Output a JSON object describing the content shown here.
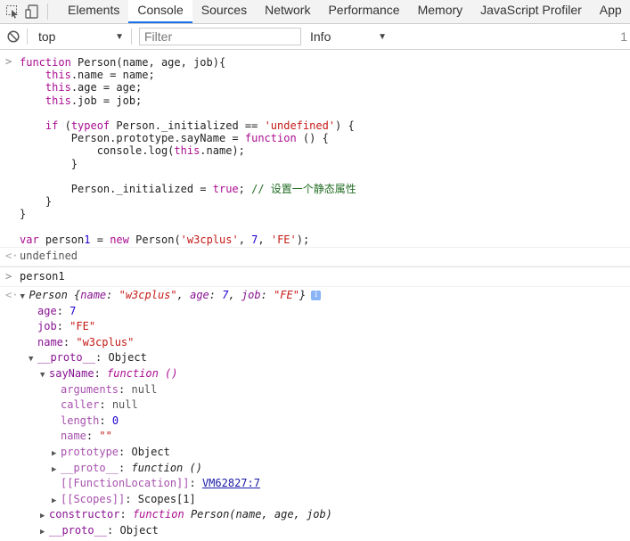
{
  "toolbar": {
    "tabs": [
      "Elements",
      "Console",
      "Sources",
      "Network",
      "Performance",
      "Memory",
      "JavaScript Profiler",
      "App"
    ],
    "active_tab": "Console"
  },
  "filterbar": {
    "context": "top",
    "filter_placeholder": "Filter",
    "level": "Info",
    "hidden_count": "1"
  },
  "console": {
    "input_code_lines": [
      "function Person(name, age, job){",
      "    this.name = name;",
      "    this.age = age;",
      "    this.job = job;",
      "",
      "    if (typeof Person._initialized == 'undefined') {",
      "        Person.prototype.sayName = function () {",
      "            console.log(this.name);",
      "        }",
      "",
      "        Person._initialized = true; // 设置一个静态属性",
      "    }",
      "}",
      "",
      "var person1 = new Person('w3cplus', 7, 'FE');"
    ],
    "result1": "undefined",
    "input2": "person1",
    "object_summary": "Person {name: \"w3cplus\", age: 7, job: \"FE\"}",
    "props": [
      {
        "key": "age",
        "value": "7"
      },
      {
        "key": "job",
        "value": "\"FE\""
      },
      {
        "key": "name",
        "value": "\"w3cplus\""
      }
    ],
    "proto": {
      "key": "__proto__",
      "value": "Object"
    },
    "sayname": {
      "key": "sayName",
      "value": "function ()"
    },
    "fn_props": [
      {
        "key": "arguments",
        "value": "null"
      },
      {
        "key": "caller",
        "value": "null"
      },
      {
        "key": "length",
        "value": "0"
      },
      {
        "key": "name",
        "value": "\"\""
      }
    ],
    "fn_prototype": {
      "key": "prototype",
      "value": "Object"
    },
    "fn_proto": {
      "key": "__proto__",
      "value": "function ()"
    },
    "fn_location": {
      "key": "[[FunctionLocation]]",
      "value": "VM62827:7"
    },
    "fn_scopes": {
      "key": "[[Scopes]]",
      "value": "Scopes[1]"
    },
    "constructor": {
      "key": "constructor",
      "value": "function Person(name, age, job)"
    },
    "proto2": {
      "key": "__proto__",
      "value": "Object"
    }
  }
}
